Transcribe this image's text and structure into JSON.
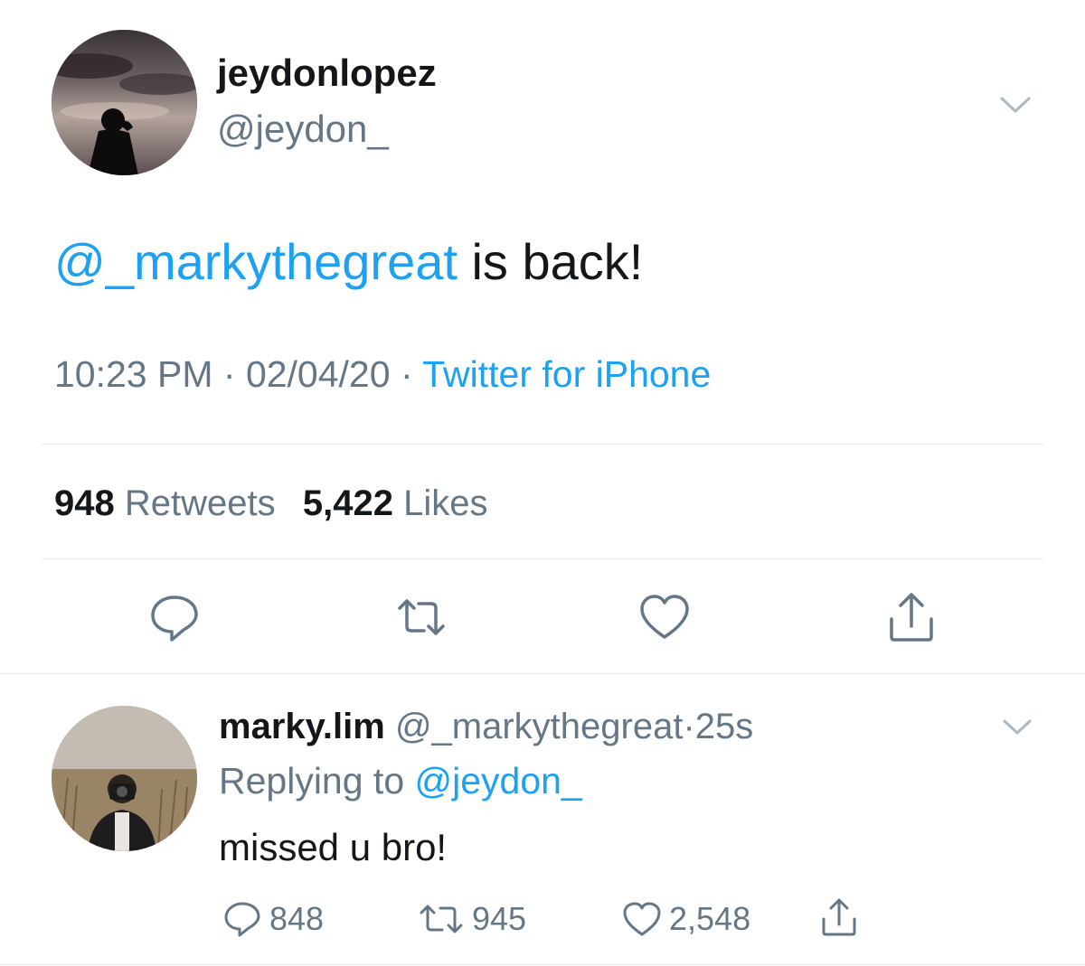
{
  "tweet": {
    "display_name": "jeydonlopez",
    "handle": "@jeydon_",
    "text_mention": "@_markythegreat",
    "text_rest": " is back!",
    "time": "10:23 PM",
    "date": "02/04/20",
    "separator": " · ",
    "source": "Twitter for iPhone",
    "retweets_count": "948",
    "retweets_label": "Retweets",
    "likes_count": "5,422",
    "likes_label": "Likes"
  },
  "actions": [
    {
      "icon": "reply-icon"
    },
    {
      "icon": "retweet-icon"
    },
    {
      "icon": "like-icon"
    },
    {
      "icon": "share-icon"
    }
  ],
  "reply": {
    "display_name": "marky.lim",
    "handle": "@_markythegreat",
    "separator": "·",
    "time_ago": "25s",
    "replying_prefix": "Replying to ",
    "replying_to": "@jeydon_",
    "text": "missed u bro!",
    "reply_count": "848",
    "retweet_count": "945",
    "like_count": "2,548"
  },
  "colors": {
    "link": "#1da1f2",
    "secondary_text": "#657786",
    "primary_text": "#14171a",
    "divider": "#e1e8ed"
  }
}
